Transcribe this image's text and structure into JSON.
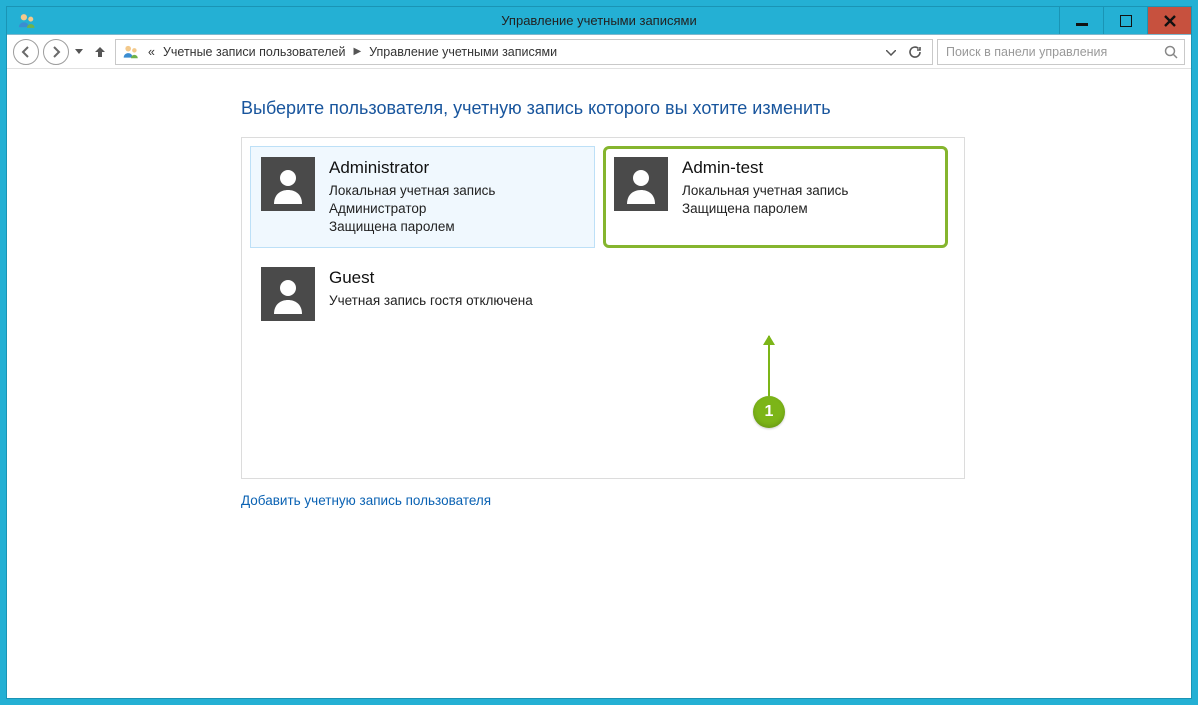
{
  "window": {
    "title": "Управление учетными записями"
  },
  "breadcrumb": {
    "prefix": "«",
    "item1": "Учетные записи пользователей",
    "item2": "Управление учетными записями"
  },
  "search": {
    "placeholder": "Поиск в панели управления"
  },
  "heading": "Выберите пользователя, учетную запись которого вы хотите изменить",
  "accounts": [
    {
      "name": "Administrator",
      "line1": "Локальная учетная запись",
      "line2": "Администратор",
      "line3": "Защищена паролем"
    },
    {
      "name": "Admin-test",
      "line1": "Локальная учетная запись",
      "line2": "Защищена паролем",
      "line3": ""
    },
    {
      "name": "Guest",
      "line1": "Учетная запись гостя отключена",
      "line2": "",
      "line3": ""
    }
  ],
  "add_user_link": "Добавить учетную запись пользователя",
  "callout": {
    "number": "1"
  },
  "colors": {
    "accent": "#24b0d4",
    "link": "#0a62b3",
    "highlight": "#85b52e"
  }
}
